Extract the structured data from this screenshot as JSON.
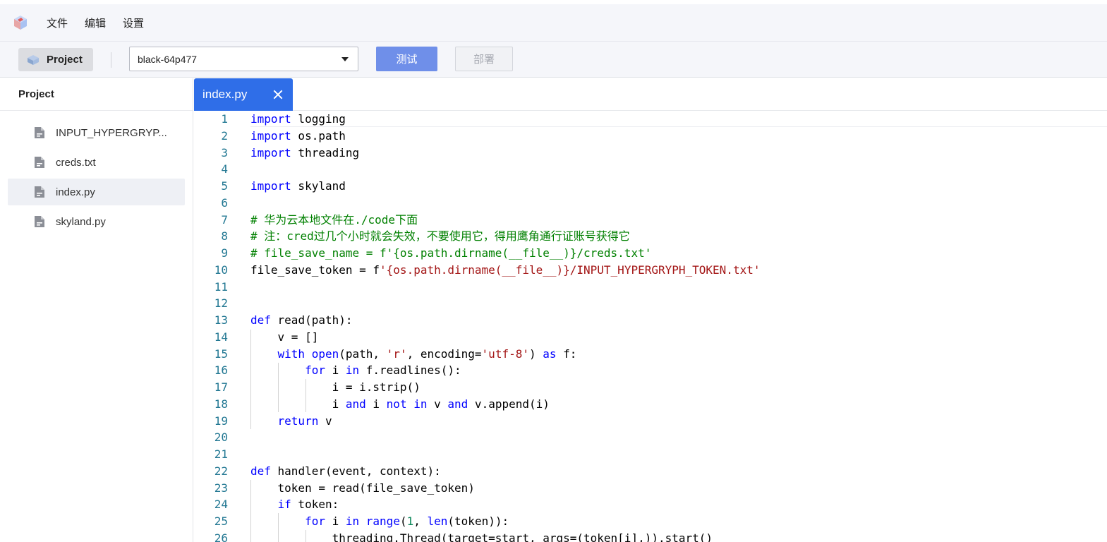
{
  "menu": [
    "文件",
    "编辑",
    "设置"
  ],
  "toolbar": {
    "project_label": "Project",
    "function_select": "black-64p477",
    "test_label": "测试",
    "deploy_label": "部署"
  },
  "sidebar": {
    "title": "Project",
    "files": [
      "INPUT_HYPERGRYP...",
      "creds.txt",
      "index.py",
      "skyland.py"
    ],
    "active_index": 2
  },
  "tab": {
    "label": "index.py"
  },
  "code": [
    {
      "n": "1",
      "tokens": [
        [
          "kw",
          "import"
        ],
        [
          "",
          "logging"
        ]
      ],
      "sep": [
        " "
      ]
    },
    {
      "n": "2"
    },
    {
      "n": "3"
    },
    {
      "n": "4"
    },
    {
      "n": "5"
    },
    {
      "n": "6"
    },
    {
      "n": "7"
    },
    {
      "n": "8"
    },
    {
      "n": "9"
    },
    {
      "n": "10"
    },
    {
      "n": "11"
    },
    {
      "n": "12"
    },
    {
      "n": "13"
    },
    {
      "n": "14"
    },
    {
      "n": "15"
    },
    {
      "n": "16"
    },
    {
      "n": "17"
    },
    {
      "n": "18"
    },
    {
      "n": "19"
    },
    {
      "n": "20"
    },
    {
      "n": "21"
    },
    {
      "n": "22"
    },
    {
      "n": "23"
    },
    {
      "n": "24"
    },
    {
      "n": "25"
    },
    {
      "n": "26"
    }
  ],
  "code_lines": [
    [
      [
        "kw",
        "import"
      ],
      [
        "t",
        " logging"
      ]
    ],
    [
      [
        "kw",
        "import"
      ],
      [
        "t",
        " os.path"
      ]
    ],
    [
      [
        "kw",
        "import"
      ],
      [
        "t",
        " threading"
      ]
    ],
    [],
    [
      [
        "kw",
        "import"
      ],
      [
        "t",
        " skyland"
      ]
    ],
    [],
    [
      [
        "cm",
        "# 华为云本地文件在./code下面"
      ]
    ],
    [
      [
        "cm",
        "# 注：cred过几个小时就会失效，不要使用它，得用鹰角通行证账号获得它"
      ]
    ],
    [
      [
        "cm",
        "# file_save_name = f'{os.path.dirname(__file__)}/creds.txt'"
      ]
    ],
    [
      [
        "t",
        "file_save_token = f"
      ],
      [
        "str",
        "'{os.path.dirname(__file__)}/INPUT_HYPERGRYPH_TOKEN.txt'"
      ]
    ],
    [],
    [],
    [
      [
        "kw",
        "def"
      ],
      [
        "t",
        " read(path):"
      ]
    ],
    [
      [
        "t",
        "    v = []"
      ]
    ],
    [
      [
        "t",
        "    "
      ],
      [
        "kw",
        "with"
      ],
      [
        "t",
        " "
      ],
      [
        "bi",
        "open"
      ],
      [
        "t",
        "(path, "
      ],
      [
        "str",
        "'r'"
      ],
      [
        "t",
        ", encoding="
      ],
      [
        "str",
        "'utf-8'"
      ],
      [
        "t",
        ") "
      ],
      [
        "kw",
        "as"
      ],
      [
        "t",
        " f:"
      ]
    ],
    [
      [
        "t",
        "        "
      ],
      [
        "kw",
        "for"
      ],
      [
        "t",
        " i "
      ],
      [
        "kw",
        "in"
      ],
      [
        "t",
        " f.readlines():"
      ]
    ],
    [
      [
        "t",
        "            i = i.strip()"
      ]
    ],
    [
      [
        "t",
        "            i "
      ],
      [
        "kw",
        "and"
      ],
      [
        "t",
        " i "
      ],
      [
        "kw",
        "not"
      ],
      [
        "t",
        " "
      ],
      [
        "kw",
        "in"
      ],
      [
        "t",
        " v "
      ],
      [
        "kw",
        "and"
      ],
      [
        "t",
        " v.append(i)"
      ]
    ],
    [
      [
        "t",
        "    "
      ],
      [
        "kw",
        "return"
      ],
      [
        "t",
        " v"
      ]
    ],
    [],
    [],
    [
      [
        "kw",
        "def"
      ],
      [
        "t",
        " handler(event, context):"
      ]
    ],
    [
      [
        "t",
        "    token = read(file_save_token)"
      ]
    ],
    [
      [
        "t",
        "    "
      ],
      [
        "kw",
        "if"
      ],
      [
        "t",
        " token:"
      ]
    ],
    [
      [
        "t",
        "        "
      ],
      [
        "kw",
        "for"
      ],
      [
        "t",
        " i "
      ],
      [
        "kw",
        "in"
      ],
      [
        "t",
        " "
      ],
      [
        "bi",
        "range"
      ],
      [
        "t",
        "("
      ],
      [
        "num",
        "1"
      ],
      [
        "t",
        ", "
      ],
      [
        "bi",
        "len"
      ],
      [
        "t",
        "(token)):"
      ]
    ],
    [
      [
        "t",
        "            threading.Thread(target=start, args=(token[i],)).start()"
      ]
    ]
  ],
  "colors": {
    "accent": "#2f6ee8",
    "test_button": "#6f8fe9",
    "keyword": "#0000ff",
    "string": "#a31515",
    "comment": "#008000",
    "number": "#098658",
    "line_number": "#237893"
  },
  "icons": [
    "app-logo-icon",
    "project-cube-icon",
    "dropdown-caret-icon",
    "file-icon",
    "close-icon"
  ]
}
